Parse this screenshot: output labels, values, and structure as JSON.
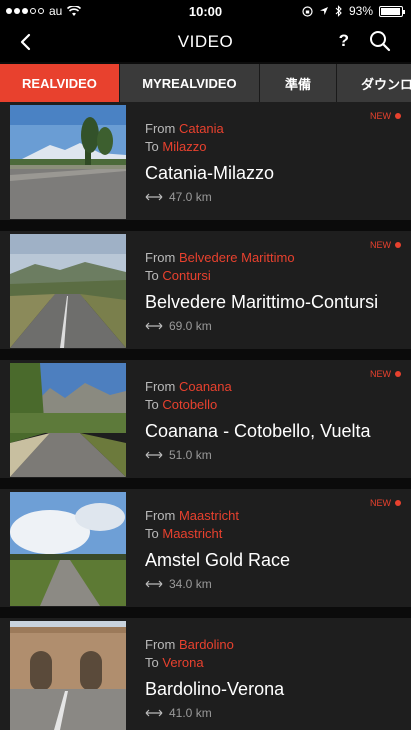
{
  "status": {
    "carrier": "au",
    "time": "10:00",
    "battery": "93%",
    "battery_level": 0.93
  },
  "nav": {
    "title": "VIDEO",
    "help": "?"
  },
  "tabs": [
    {
      "label": "REALVIDEO",
      "active": true
    },
    {
      "label": "MYREALVIDEO",
      "active": false
    },
    {
      "label": "準備",
      "active": false
    },
    {
      "label": "ダウンロ",
      "active": false
    }
  ],
  "labels": {
    "from": "From",
    "to": "To",
    "new": "NEW"
  },
  "videos": [
    {
      "from": "Catania",
      "to": "Milazzo",
      "title": "Catania-Milazzo",
      "distance": "47.0 km",
      "new": true
    },
    {
      "from": "Belvedere Marittimo",
      "to": "Contursi",
      "title": "Belvedere Marittimo-Contursi",
      "distance": "69.0 km",
      "new": true
    },
    {
      "from": "Coanana",
      "to": "Cotobello",
      "title": "Coanana - Cotobello, Vuelta",
      "distance": "51.0 km",
      "new": true
    },
    {
      "from": "Maastricht",
      "to": "Maastricht",
      "title": "Amstel Gold Race",
      "distance": "34.0 km",
      "new": true
    },
    {
      "from": "Bardolino",
      "to": "Verona",
      "title": "Bardolino-Verona",
      "distance": "41.0 km",
      "new": false
    }
  ]
}
